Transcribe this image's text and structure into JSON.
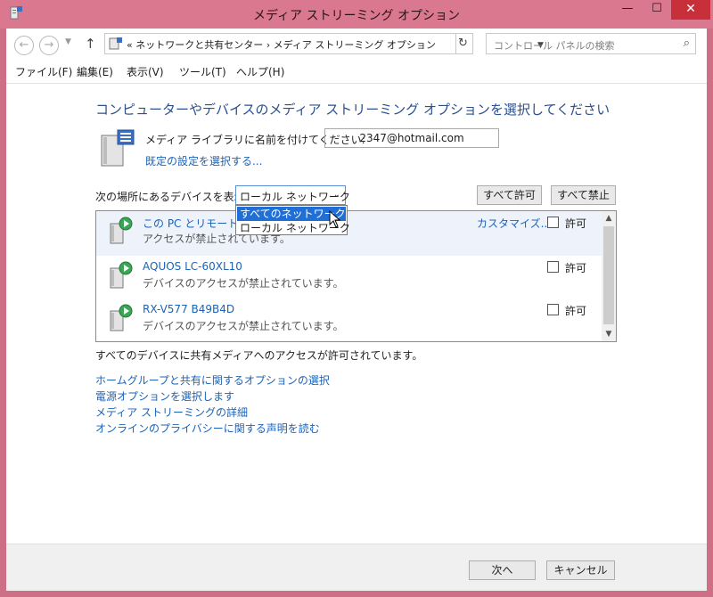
{
  "window": {
    "title": "メディア ストリーミング オプション",
    "minimize": "—",
    "maximize": "☐",
    "close": "✕"
  },
  "address_bar": {
    "prefix": "«",
    "crumb1": "ネットワークと共有センター",
    "separator": "›",
    "crumb2": "メディア ストリーミング オプション",
    "search_placeholder": "コントロール パネルの検索"
  },
  "menu": [
    "ファイル(F)",
    "編集(E)",
    "表示(V)",
    "ツール(T)",
    "ヘルプ(H)"
  ],
  "heading": "コンピューターやデバイスのメディア ストリーミング オプションを選択してください",
  "library": {
    "label": "メディア ライブラリに名前を付けてください:",
    "value": "2347@hotmail.com",
    "default_link": "既定の設定を選択する..."
  },
  "filter": {
    "label": "次の場所にあるデバイスを表示:",
    "selected": "ローカル ネットワーク",
    "options": [
      "すべてのネットワーク",
      "ローカル ネットワーク"
    ],
    "highlighted_option": "すべてのネットワーク"
  },
  "buttons": {
    "allow_all": "すべて許可",
    "block_all": "すべて禁止",
    "next": "次へ",
    "cancel": "キャンセル"
  },
  "devices": [
    {
      "name": "この PC とリモート接続",
      "status": "アクセスが禁止されています。",
      "customize": "カスタマイズ...",
      "allow_label": "許可",
      "allowed": false
    },
    {
      "name": "AQUOS LC-60XL10",
      "status": "デバイスのアクセスが禁止されています。",
      "allow_label": "許可",
      "allowed": false
    },
    {
      "name": "RX-V577 B49B4D",
      "status": "デバイスのアクセスが禁止されています。",
      "allow_label": "許可",
      "allowed": false
    }
  ],
  "status_text": "すべてのデバイスに共有メディアへのアクセスが許可されています。",
  "links": [
    "ホームグループと共有に関するオプションの選択",
    "電源オプションを選択します",
    "メディア ストリーミングの詳細",
    "オンラインのプライバシーに関する声明を読む"
  ],
  "colors": {
    "title_bar": "#d9788e",
    "close_button": "#c7303a",
    "link": "#1c63b7",
    "heading": "#2b4f8f",
    "selection": "#1f6fd6"
  }
}
